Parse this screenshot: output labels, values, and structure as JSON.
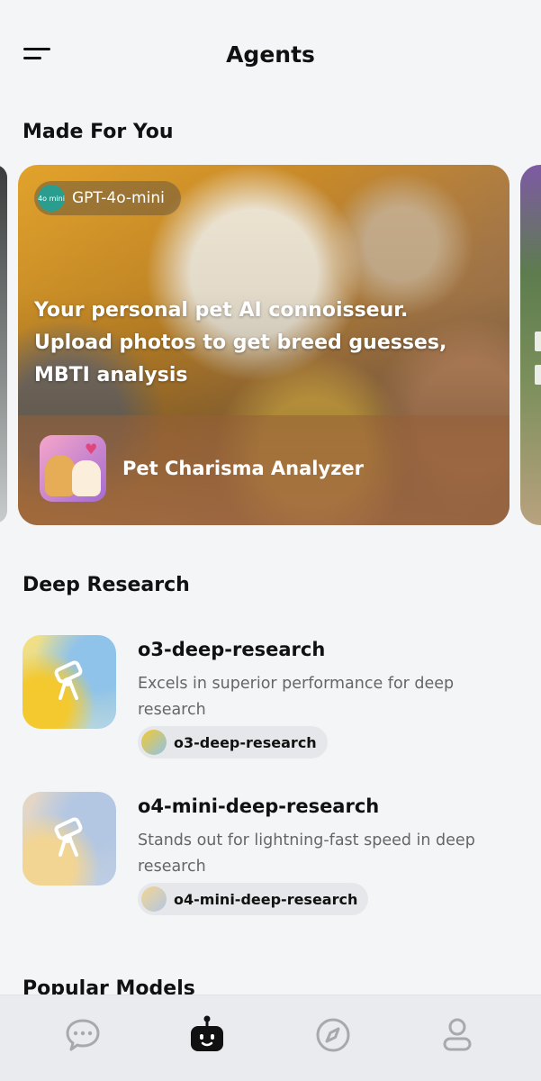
{
  "header": {
    "title": "Agents",
    "menu_icon": "menu-icon"
  },
  "made_for_you": {
    "section_title": "Made For You",
    "featured": {
      "model_badge": "GPT-4o-mini",
      "model_logo_text": "4o mini",
      "description": "Your personal pet AI connoisseur. Upload photos to get breed guesses, MBTI analysis",
      "agent_name": "Pet Charisma Analyzer"
    }
  },
  "deep_research": {
    "section_title": "Deep Research",
    "items": [
      {
        "title": "o3-deep-research",
        "description": "Excels in superior performance for deep research",
        "chip_label": "o3-deep-research",
        "icon": "telescope-icon"
      },
      {
        "title": "o4-mini-deep-research",
        "description": "Stands out for lightning-fast speed in deep research",
        "chip_label": "o4-mini-deep-research",
        "icon": "telescope-icon"
      }
    ]
  },
  "popular_models": {
    "section_title": "Popular Models"
  },
  "bottom_nav": [
    {
      "name": "chat",
      "icon": "chat-bubble-icon",
      "active": false
    },
    {
      "name": "agents",
      "icon": "robot-icon",
      "active": true
    },
    {
      "name": "explore",
      "icon": "compass-icon",
      "active": false
    },
    {
      "name": "profile",
      "icon": "person-icon",
      "active": false
    }
  ]
}
